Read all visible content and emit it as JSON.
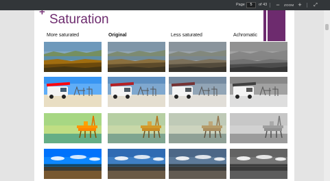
{
  "toolbar": {
    "page_label": "Page",
    "page_value": "5",
    "page_of": "of 43",
    "zoom_out_icon": "minus-icon",
    "zoom_label": "ZOOM",
    "zoom_in_icon": "plus-icon",
    "fullscreen_icon": "expand-icon",
    "background": "#323639"
  },
  "slide": {
    "title": "Saturation",
    "accent_color": "#6d2b6e",
    "columns": [
      {
        "label": "More saturated",
        "bold": false,
        "filter": "saturate(1.9)"
      },
      {
        "label": "Original",
        "bold": true,
        "filter": "none"
      },
      {
        "label": "Less saturated",
        "bold": false,
        "filter": "saturate(0.45)"
      },
      {
        "label": "Achromatic",
        "bold": false,
        "filter": "grayscale(1)"
      }
    ],
    "rows": [
      {
        "subject": "coastal-landscape"
      },
      {
        "subject": "white-van-on-beach"
      },
      {
        "subject": "oil-platform"
      },
      {
        "subject": "pier-and-sky"
      }
    ]
  }
}
